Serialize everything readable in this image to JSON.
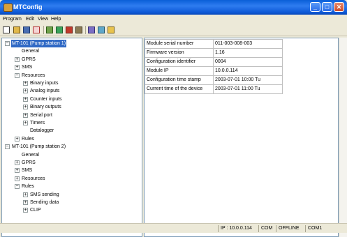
{
  "window": {
    "title": "MTConfig",
    "minimize": "_",
    "maximize": "□",
    "close": "✕"
  },
  "menu": [
    "Program",
    "Edit",
    "View",
    "Help"
  ],
  "toolbar": {
    "icons": [
      "new-icon",
      "open-icon",
      "save-icon",
      "cut-icon",
      "copy-icon",
      "paste-icon",
      "module-icon",
      "plug-icon",
      "tree-icon",
      "wand-icon",
      "folder-icon"
    ]
  },
  "tree": {
    "nodes": [
      {
        "label": "MT-101 (Pump station 1)",
        "level": 0,
        "expander": "−",
        "selected": true
      },
      {
        "label": "General",
        "level": 1,
        "expander": ""
      },
      {
        "label": "GPRS",
        "level": 1,
        "expander": "+"
      },
      {
        "label": "SMS",
        "level": 1,
        "expander": "+"
      },
      {
        "label": "Resources",
        "level": 1,
        "expander": "−"
      },
      {
        "label": "Binary inputs",
        "level": 2,
        "expander": "+"
      },
      {
        "label": "Analog inputs",
        "level": 2,
        "expander": "+"
      },
      {
        "label": "Counter inputs",
        "level": 2,
        "expander": "+"
      },
      {
        "label": "Binary outputs",
        "level": 2,
        "expander": "+"
      },
      {
        "label": "Serial port",
        "level": 2,
        "expander": "+"
      },
      {
        "label": "Timers",
        "level": 2,
        "expander": "+"
      },
      {
        "label": "Datalogger",
        "level": 2,
        "expander": ""
      },
      {
        "label": "Rules",
        "level": 1,
        "expander": "+"
      },
      {
        "label": "MT-101 (Pump station 2)",
        "level": 0,
        "expander": "−"
      },
      {
        "label": "General",
        "level": 1,
        "expander": ""
      },
      {
        "label": "GPRS",
        "level": 1,
        "expander": "+"
      },
      {
        "label": "SMS",
        "level": 1,
        "expander": "+"
      },
      {
        "label": "Resources",
        "level": 1,
        "expander": "+"
      },
      {
        "label": "Rules",
        "level": 1,
        "expander": "−"
      },
      {
        "label": "SMS sending",
        "level": 2,
        "expander": "+"
      },
      {
        "label": "Sending data",
        "level": 2,
        "expander": "+"
      },
      {
        "label": "CLIP",
        "level": 2,
        "expander": "+"
      }
    ]
  },
  "properties": [
    {
      "key": "Module serial number",
      "value": "011-003-008-003"
    },
    {
      "key": "Firmware version",
      "value": "1.16"
    },
    {
      "key": "Configuration identifier",
      "value": "0004"
    },
    {
      "key": "Module IP",
      "value": "10.0.0.114"
    },
    {
      "key": "Configuration time stamp",
      "value": "2003-07-01 10:00 Tu"
    },
    {
      "key": "Current time of the device",
      "value": "2003-07-01 11:00 Tu"
    }
  ],
  "status": {
    "ip": "IP : 10.0.0.114",
    "port": "COM",
    "state": "OFFLINE",
    "com": "COM1"
  }
}
